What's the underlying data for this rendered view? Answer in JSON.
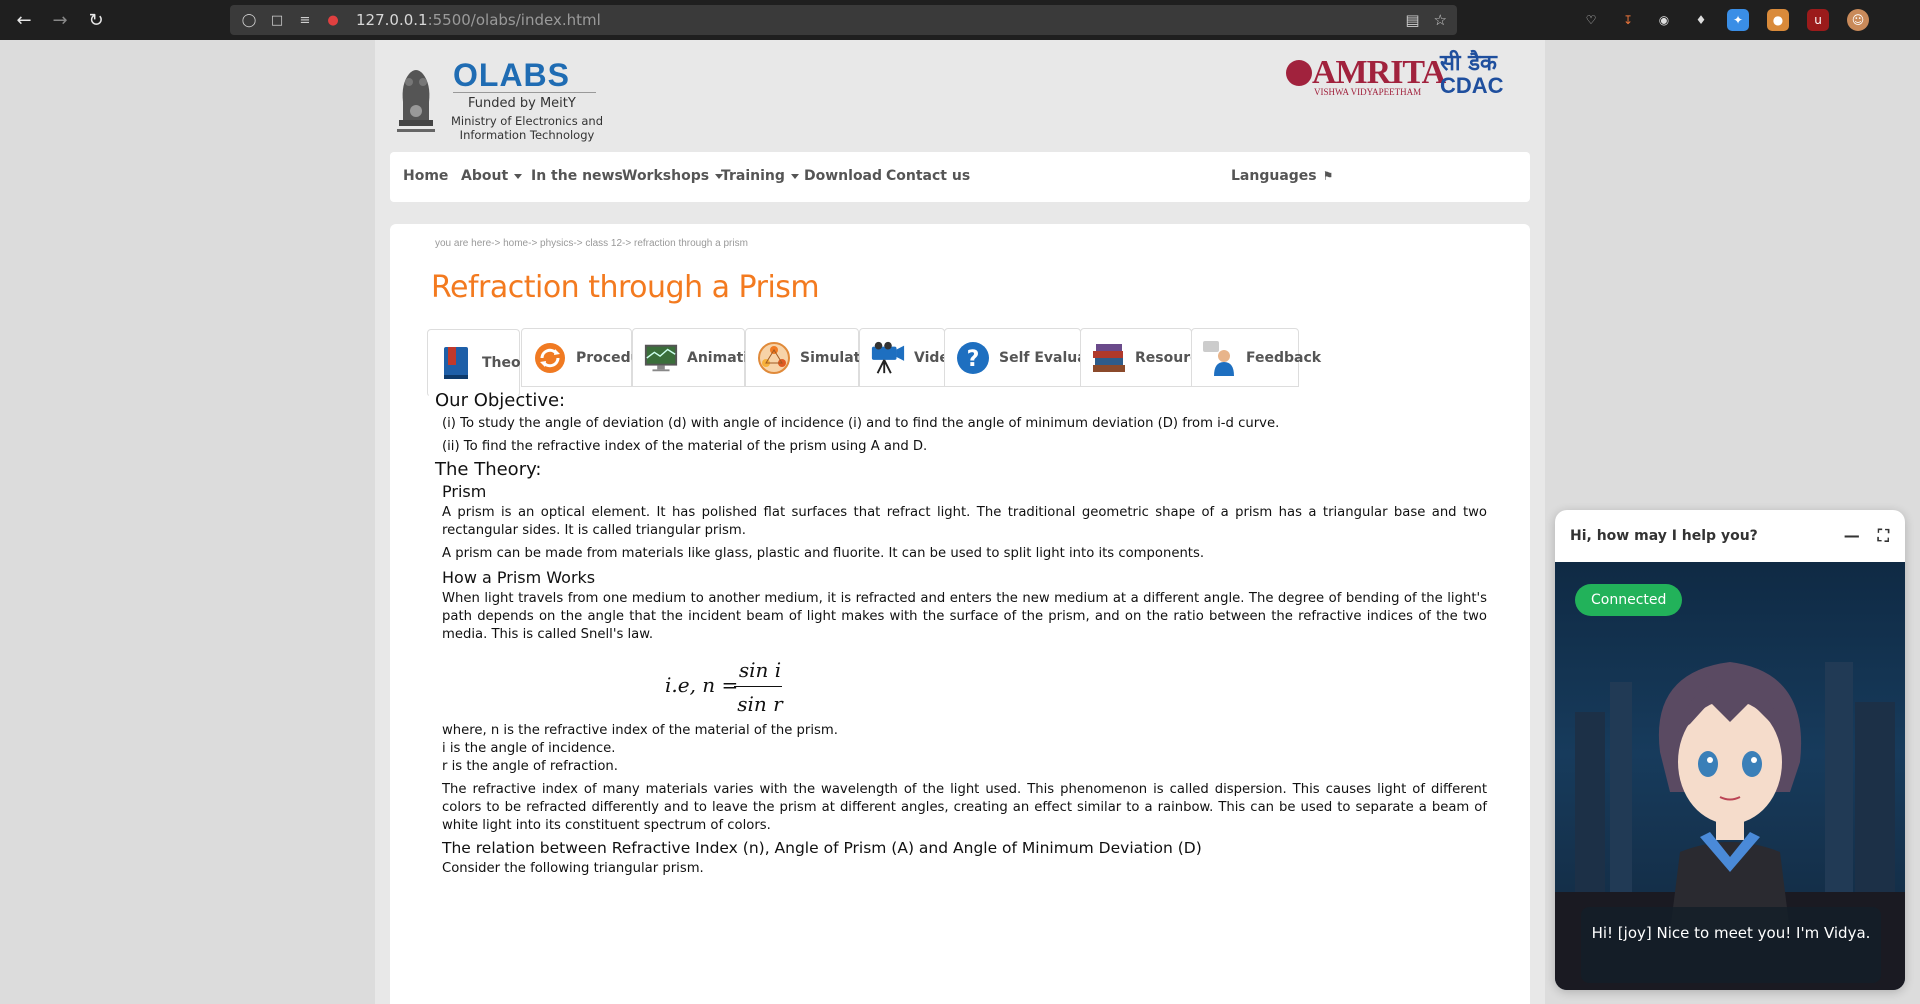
{
  "browser": {
    "url_host": "127.0.0.1",
    "url_rest": ":5500/olabs/index.html"
  },
  "header": {
    "brand": "OLABS",
    "funded_by": "Funded by MeitY",
    "ministry": "Ministry of Electronics and Information Technology",
    "amrita_name": "AMRITA",
    "amrita_sub": "VISHWA VIDYAPEETHAM",
    "cdac_hindi": "सी डैक",
    "cdac_en": "CDAC"
  },
  "nav": {
    "items": [
      "Home",
      "About",
      "In the news",
      "Workshops",
      "Training",
      "Download",
      "Contact us"
    ],
    "languages": "Languages"
  },
  "breadcrumb": "you are here-> home-> physics-> class 12-> refraction through a prism",
  "title": "Refraction through a Prism",
  "tabs": [
    {
      "label": "Theory",
      "icon": "book-icon"
    },
    {
      "label": "Procedure",
      "icon": "refresh-icon"
    },
    {
      "label": "Animation",
      "icon": "monitor-icon"
    },
    {
      "label": "Simulator",
      "icon": "simulator-icon"
    },
    {
      "label": "Video",
      "icon": "video-camera-icon"
    },
    {
      "label": "Self Evaluation",
      "icon": "question-icon"
    },
    {
      "label": "Resources",
      "icon": "books-icon"
    },
    {
      "label": "Feedback",
      "icon": "feedback-icon"
    }
  ],
  "content": {
    "objective_heading": "Our Objective:",
    "objective_1": "(i) To study the angle of deviation (d) with angle of incidence (i) and to find the angle of minimum deviation (D) from i-d curve.",
    "objective_2": "(ii) To find the refractive index of the material of the prism using A and D.",
    "theory_heading": "The Theory:",
    "prism_heading": "Prism",
    "prism_p1": "A prism is an optical element. It has polished flat surfaces that refract light. The traditional geometric shape of a prism has a triangular base and two rectangular sides. It is called triangular prism.",
    "prism_p2": "A prism can be made from materials like glass, plastic and fluorite. It can be used to split light into its components.",
    "works_heading": "How a Prism Works",
    "works_p1": "When light travels from one medium to another medium, it is refracted and enters the new medium at a different angle. The degree of bending of the light's path depends on the angle that the incident beam of light makes with the surface of the prism, and on the ratio between the refractive indices of the two media. This is called Snell's law.",
    "formula_lhs": "i.e, n =",
    "formula_num": "sin i",
    "formula_den": "sin r",
    "where_1": "where, n is the refractive index of the material of the prism.",
    "where_2": "i is the angle of incidence.",
    "where_3": "r is the angle of refraction.",
    "dispersion_p": "The refractive index of many materials varies with the wavelength of the light used. This phenomenon is called dispersion. This causes light of different colors to be refracted differently and to leave the prism at different angles, creating an effect similar to a rainbow. This can be used to separate a beam of white light into its constituent spectrum of colors.",
    "relation_heading": "The relation between Refractive Index (n), Angle of Prism (A) and Angle of Minimum Deviation (D)",
    "consider": "Consider the following triangular prism."
  },
  "chat": {
    "header": "Hi, how may I help you?",
    "status": "Connected",
    "message": "Hi! [joy] Nice to meet you! I'm Vidya."
  },
  "colors": {
    "title_orange": "#f37a1f",
    "olabs_blue": "#1f6cb3",
    "amrita_maroon": "#a1223d",
    "connected_green": "#22b25a"
  }
}
